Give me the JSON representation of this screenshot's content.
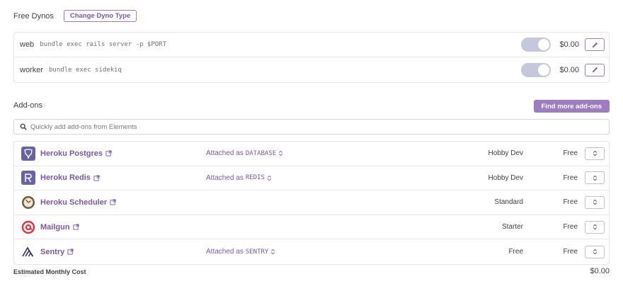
{
  "dynos": {
    "title": "Free Dynos",
    "change_type_label": "Change Dyno Type",
    "rows": [
      {
        "name": "web",
        "command": "bundle exec rails server -p $PORT",
        "cost": "$0.00"
      },
      {
        "name": "worker",
        "command": "bundle exec sidekiq",
        "cost": "$0.00"
      }
    ]
  },
  "addons": {
    "title": "Add-ons",
    "find_more_label": "Find more add-ons",
    "search_placeholder": "Quickly add add-ons from Elements",
    "attached_prefix": "Attached as",
    "rows": [
      {
        "name": "Heroku Postgres",
        "icon": "heroku-postgres-logo",
        "attached_as": "DATABASE",
        "plan": "Hobby Dev",
        "price": "Free"
      },
      {
        "name": "Heroku Redis",
        "icon": "heroku-redis-logo",
        "attached_as": "REDIS",
        "plan": "Hobby Dev",
        "price": "Free"
      },
      {
        "name": "Heroku Scheduler",
        "icon": "heroku-scheduler-logo",
        "attached_as": "",
        "plan": "Standard",
        "price": "Free"
      },
      {
        "name": "Mailgun",
        "icon": "mailgun-logo",
        "attached_as": "",
        "plan": "Starter",
        "price": "Free"
      },
      {
        "name": "Sentry",
        "icon": "sentry-logo",
        "attached_as": "SENTRY",
        "plan": "Free",
        "price": "Free"
      }
    ]
  },
  "footer": {
    "estimated_label": "Estimated Monthly Cost",
    "total": "$0.00"
  },
  "colors": {
    "accent": "#79589f",
    "accent_light": "#9e7cc1",
    "toggle_track": "#c4c8da",
    "mailgun_red": "#e8303d"
  }
}
